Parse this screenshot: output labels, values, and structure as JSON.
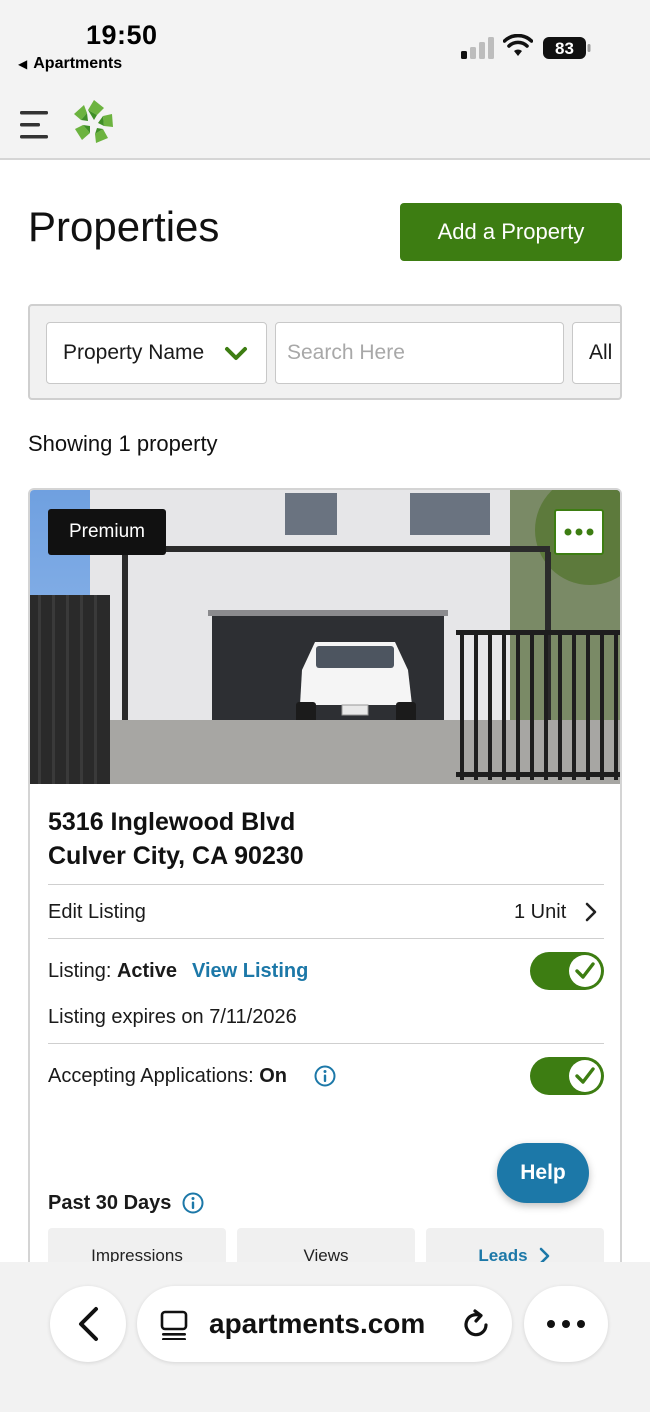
{
  "status_bar": {
    "time": "19:50",
    "back_app": "Apartments",
    "battery": "83"
  },
  "app_nav": {
    "menu_icon": "hamburger-icon",
    "logo_icon": "apartments-logo-icon"
  },
  "page": {
    "title": "Properties",
    "add_button": "Add a Property"
  },
  "filters": {
    "select_value": "Property Name",
    "search_placeholder": "Search Here",
    "status_value": "All"
  },
  "results": {
    "showing": "Showing 1 property"
  },
  "property": {
    "badge": "Premium",
    "address_line1": "5316 Inglewood Blvd",
    "address_line2": "Culver City, CA 90230",
    "edit_listing": "Edit Listing",
    "unit_count": "1 Unit",
    "listing_label": "Listing: ",
    "listing_status": "Active",
    "view_listing": "View Listing",
    "listing_toggle_on": true,
    "expires": "Listing expires on 7/11/2026",
    "accepting_label": "Accepting Applications: ",
    "accepting_status": "On",
    "accepting_toggle_on": true,
    "past_days": "Past 30 Days",
    "stat_tabs": [
      "Impressions",
      "Views",
      "Leads"
    ]
  },
  "help": {
    "label": "Help"
  },
  "browser": {
    "url": "apartments.com"
  },
  "colors": {
    "brand_green": "#3d7d12",
    "link_blue": "#1c78a8"
  }
}
